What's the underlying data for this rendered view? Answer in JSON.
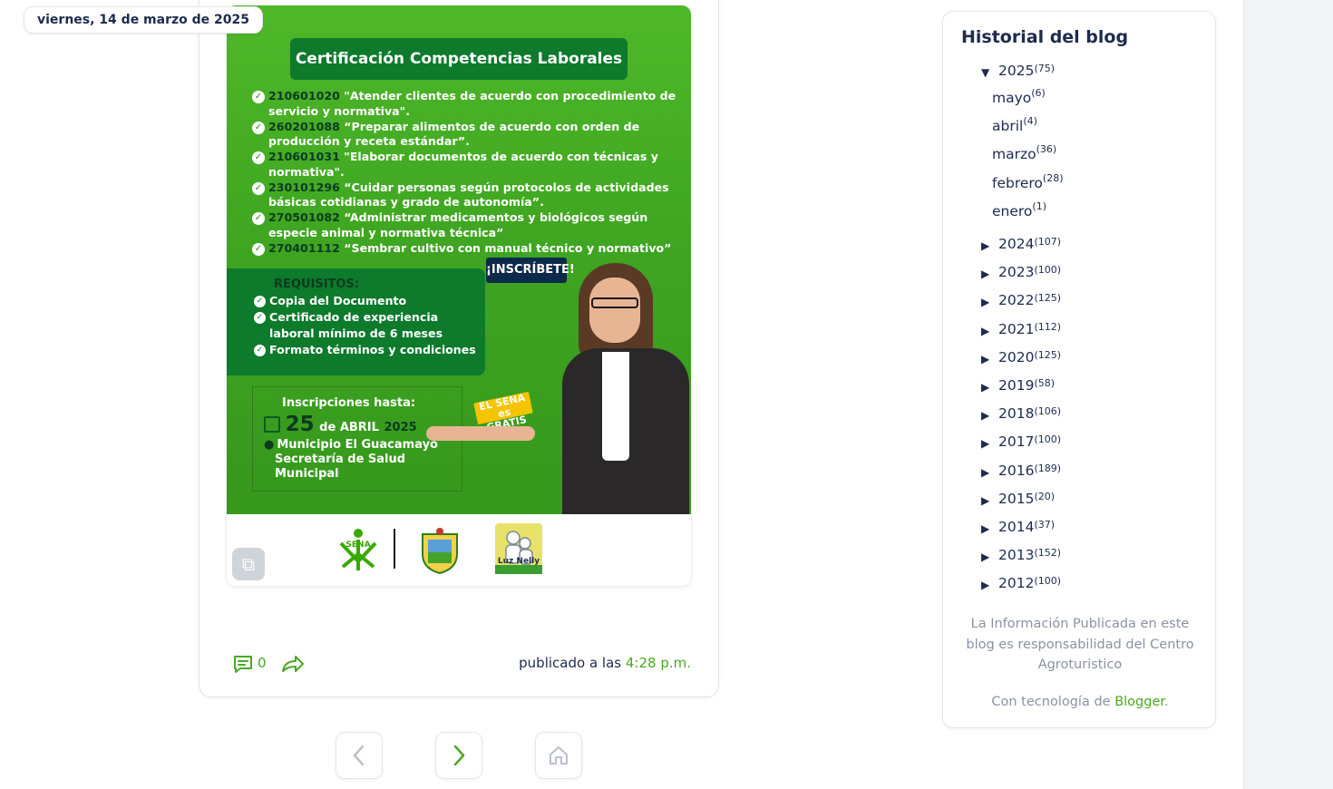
{
  "post": {
    "date": "viernes, 14 de marzo de 2025",
    "flyer": {
      "title": "Certificación Competencias Laborales",
      "competencies": [
        {
          "code": "210601020",
          "text": "\"Atender clientes de acuerdo con procedimiento de servicio y normativa\"."
        },
        {
          "code": "260201088",
          "text": "“Preparar alimentos de acuerdo con orden de producción y receta estándar”."
        },
        {
          "code": "210601031",
          "text": "\"Elaborar documentos de acuerdo con técnicas y normativa\"."
        },
        {
          "code": "230101296",
          "text": "“Cuidar personas según protocolos de actividades básicas cotidianas y grado de autonomía”."
        },
        {
          "code": "270501082",
          "text": "“Administrar medicamentos y biológicos según especie animal y normativa técnica”"
        },
        {
          "code": "270401112",
          "text": "“Sembrar cultivo con manual técnico y normativo”"
        }
      ],
      "cta": "¡INSCRÍBETE!",
      "requirements_title": "REQUISITOS:",
      "requirements": [
        "Copia del Documento",
        "Certificado de experiencia  laboral mínimo de 6 meses",
        "Formato términos y condiciones"
      ],
      "deadline_label": "Inscripciones hasta:",
      "deadline_day": "25",
      "deadline_month": "de ABRIL",
      "deadline_year": "2025",
      "place_line1": "Municipio El Guacamayo",
      "place_line2": "Secretaría de Salud Municipal",
      "badge": "EL SENA es GRATIS",
      "sena_logo_text": "SENA",
      "luz_logo_text": "Luz Nelly"
    },
    "comment_count": "0",
    "published_label": "publicado a las",
    "published_time": "4:28 p.m."
  },
  "sidebar": {
    "title": "Historial del blog",
    "expanded_year": {
      "year": "2025",
      "count": "(75)"
    },
    "months": [
      {
        "name": "mayo",
        "count": "(6)"
      },
      {
        "name": "abril",
        "count": "(4)"
      },
      {
        "name": "marzo",
        "count": "(36)"
      },
      {
        "name": "febrero",
        "count": "(28)"
      },
      {
        "name": "enero",
        "count": "(1)"
      }
    ],
    "years": [
      {
        "year": "2024",
        "count": "(107)"
      },
      {
        "year": "2023",
        "count": "(100)"
      },
      {
        "year": "2022",
        "count": "(125)"
      },
      {
        "year": "2021",
        "count": "(112)"
      },
      {
        "year": "2020",
        "count": "(125)"
      },
      {
        "year": "2019",
        "count": "(58)"
      },
      {
        "year": "2018",
        "count": "(106)"
      },
      {
        "year": "2017",
        "count": "(100)"
      },
      {
        "year": "2016",
        "count": "(189)"
      },
      {
        "year": "2015",
        "count": "(20)"
      },
      {
        "year": "2014",
        "count": "(37)"
      },
      {
        "year": "2013",
        "count": "(152)"
      },
      {
        "year": "2012",
        "count": "(100)"
      }
    ],
    "note": "La Información Publicada en este blog es responsabilidad del Centro Agroturistico",
    "powered_prefix": "Con tecnología de",
    "powered_link": "Blogger",
    "powered_suffix": "."
  },
  "nav": {
    "prev_icon": "chevron-left-icon",
    "next_icon": "chevron-right-icon",
    "home_icon": "home-icon"
  },
  "colors": {
    "accent_green": "#4aa920",
    "text_navy": "#1d2b4f",
    "flyer_green": "#3ea421",
    "flyer_dark_green": "#0d7a2c"
  }
}
